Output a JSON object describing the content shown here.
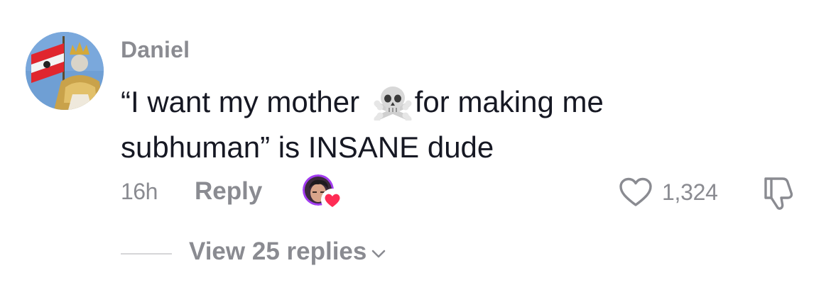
{
  "comment": {
    "username": "Daniel",
    "text_before_emoji": "“I want my mother ",
    "emoji": "skull-and-crossbones-icon",
    "text_after_emoji": "for making me subhuman” is INSANE dude",
    "timestamp": "16h",
    "reply_label": "Reply",
    "like_count": "1,324",
    "liked_by_creator": true
  },
  "replies": {
    "view_label": "View 25 replies"
  },
  "colors": {
    "text_primary": "#161823",
    "text_secondary": "#8a8b91",
    "divider": "#d6d6d8",
    "heart_badge": "#fe2c55",
    "creator_ring": "#a23cf0"
  }
}
